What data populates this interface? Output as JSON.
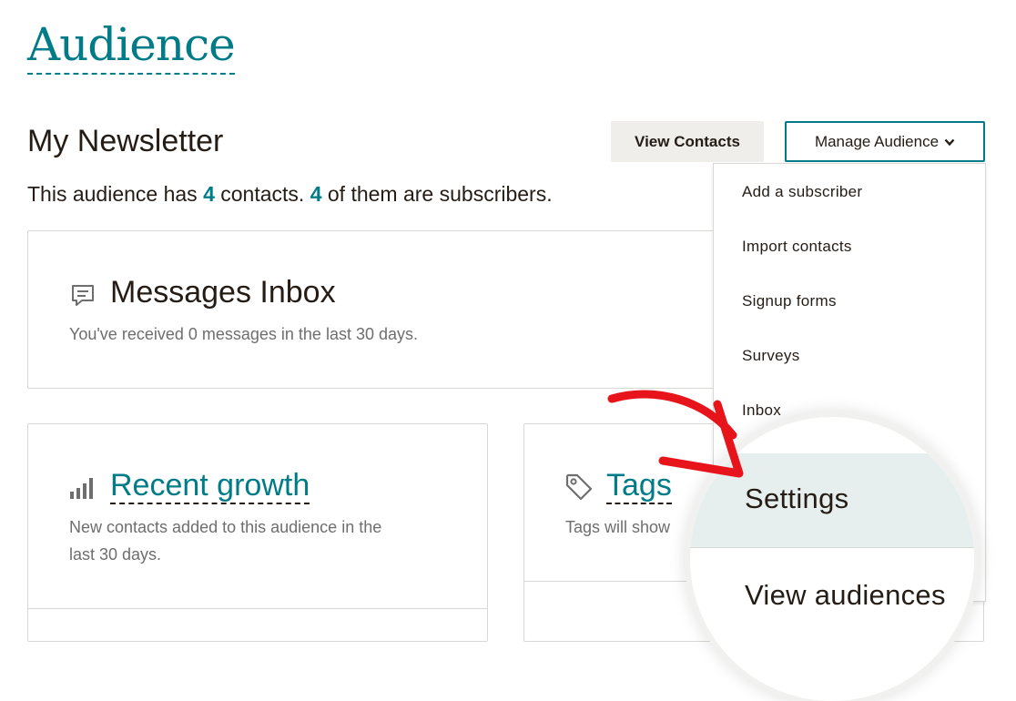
{
  "header": {
    "title": "Audience"
  },
  "audience": {
    "name": "My Newsletter",
    "summary_prefix": "This audience has",
    "contacts_count": "4",
    "summary_middle": "contacts.",
    "subscribers_count": "4",
    "summary_suffix": "of them are subscribers."
  },
  "toolbar": {
    "view_contacts_label": "View Contacts",
    "manage_audience_label": "Manage Audience"
  },
  "dropdown": {
    "items": [
      {
        "label": "Add a subscriber"
      },
      {
        "label": "Import contacts"
      },
      {
        "label": "Signup forms"
      },
      {
        "label": "Surveys"
      },
      {
        "label": "Inbox"
      }
    ],
    "magnified_items": [
      {
        "label": "Settings"
      },
      {
        "label": "View audiences"
      }
    ]
  },
  "cards": {
    "inbox": {
      "title": "Messages Inbox",
      "description": "You've received 0 messages in the last 30 days."
    },
    "growth": {
      "title": "Recent growth",
      "description_line1": "New contacts added to this audience in the",
      "description_line2": "last 30 days."
    },
    "tags": {
      "title": "Tags",
      "description": "Tags will show"
    }
  },
  "icons": {
    "inbox": "message-icon",
    "growth": "bar-chart-icon",
    "tags": "tag-icon",
    "manage": "chevron-down-icon",
    "annotation": "red-arrow-icon"
  },
  "colors": {
    "accent": "#007c89",
    "annotation_arrow": "#e8141c",
    "highlight": "#e6efee"
  }
}
